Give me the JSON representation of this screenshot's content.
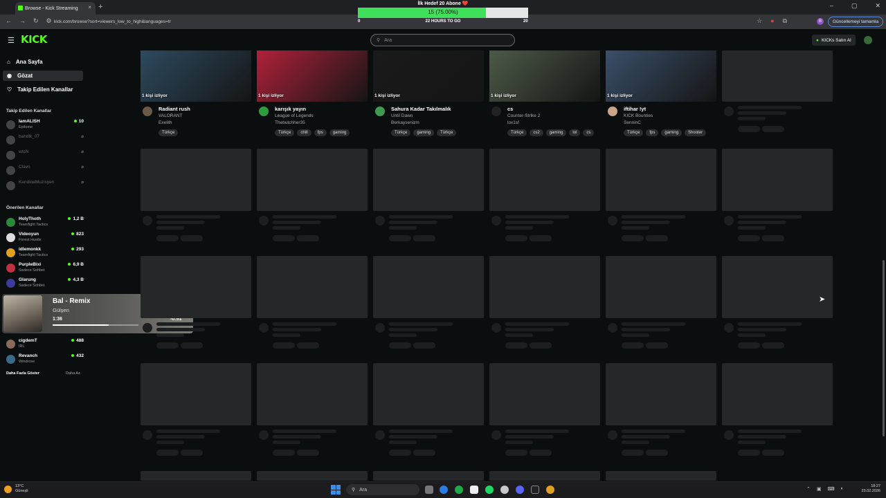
{
  "browser": {
    "tab_title": "Browse - Kick Streaming",
    "new_tab": "+",
    "tab_close": "×",
    "url": "kick.com/browse?sort=viewers_low_to_high&languages=tr",
    "update_label": "Güncellemeyi tamamla",
    "profile_initial": "B",
    "window_controls": [
      "–",
      "▢",
      "✕"
    ]
  },
  "goal": {
    "title": "İlk Hedef 20 Abone ❤️",
    "progress_text": "15 (75.00%)",
    "progress": 0.75,
    "min": "0",
    "max": "20",
    "time_left": "22 HOURS TO GO"
  },
  "header": {
    "logo": "KICK",
    "search_placeholder": "Ara",
    "kicks_label": "KICKs Satın Al"
  },
  "nav": [
    {
      "label": "Ana Sayfa",
      "icon": "home-icon"
    },
    {
      "label": "Gözat",
      "icon": "compass-icon"
    },
    {
      "label": "Takip Edilen Kanallar",
      "icon": "heart-icon"
    }
  ],
  "followed": {
    "title": "Takip Edilen Kanallar",
    "channels": [
      {
        "name": "IamALISH",
        "game": "Epitome",
        "viewers": "10",
        "live": true
      },
      {
        "name": "bahdlk_07",
        "game": "",
        "viewers": "⌀",
        "live": false
      },
      {
        "name": "wtcN",
        "game": "",
        "viewers": "⌀",
        "live": false
      },
      {
        "name": "Clavn",
        "game": "",
        "viewers": "⌀",
        "live": false
      },
      {
        "name": "KendineMuzisyen",
        "game": "",
        "viewers": "⌀",
        "live": false
      }
    ]
  },
  "recommended": {
    "title": "Önerilen Kanallar",
    "channels": [
      {
        "name": "HolyThoth",
        "game": "Teamfight Tactics",
        "viewers": "1,2 B"
      },
      {
        "name": "Videoyun",
        "game": "Forest Hustle",
        "viewers": "823"
      },
      {
        "name": "idlemonkk",
        "game": "Teamfight Tactics",
        "viewers": "293"
      },
      {
        "name": "PurpleBixi",
        "game": "Sadece Sohbet",
        "viewers": "6,9 B"
      },
      {
        "name": "Glarung",
        "game": "Sadece Sohbet",
        "viewers": "4,3 B"
      },
      {
        "name": "cigdemT",
        "game": "IRL",
        "viewers": "488"
      },
      {
        "name": "Revanch",
        "game": "Windrose",
        "viewers": "432"
      }
    ],
    "show_more": "Daha Fazla Göster",
    "show_less": "Daha Az"
  },
  "media": {
    "title": "Bal - Remix",
    "artist": "Gülşen",
    "position": "1:36",
    "remaining": "-0:51",
    "progress": 0.65
  },
  "streams": [
    {
      "title": "Radiant rush",
      "game": "VALORANT",
      "user": "Exelith",
      "watching": "1 kişi izliyor",
      "tags": [
        "Türkçe"
      ],
      "thumb": "#2d4a5f",
      "avatar": "#6b5a48"
    },
    {
      "title": "karışık yayın",
      "game": "League of Legends",
      "user": "Thebutchher35",
      "watching": "1 kişi izliyor",
      "tags": [
        "Türkçe",
        "chill",
        "fps",
        "gaming"
      ],
      "thumb": "#b0213a",
      "avatar": "#2f9a3f"
    },
    {
      "title": "Sahura Kadar Takılmalık",
      "game": "Until Dawn",
      "user": "Berkaysenizm",
      "watching": "1 kişi izliyor",
      "tags": [
        "Türkçe",
        "gaming",
        "Türkçe"
      ],
      "thumb": "#1a1a1a",
      "avatar": "#3f9a50"
    },
    {
      "title": "cs",
      "game": "Counter-Strike 2",
      "user": "lox1sf",
      "watching": "1 kişi izliyor",
      "tags": [
        "Türkçe",
        "cs2",
        "gaming",
        "lol",
        "cs"
      ],
      "thumb": "#4d5a48",
      "avatar": "#222222"
    },
    {
      "title": "iftihar !yt",
      "game": "KICK Bounties",
      "user": "SenninC",
      "watching": "1 kişi izliyor",
      "tags": [
        "Türkçe",
        "fps",
        "gaming",
        "Shooter"
      ],
      "thumb": "#3a4f6a",
      "avatar": "#c9a58a"
    }
  ],
  "taskbar": {
    "temperature": "13°C",
    "weather": "Güneşli",
    "search": "Ara",
    "time": "18:27",
    "date": "23.02.2026"
  },
  "colors": {
    "brand": "#53fc18",
    "background": "#0b0e0f",
    "skeleton": "#262729"
  }
}
